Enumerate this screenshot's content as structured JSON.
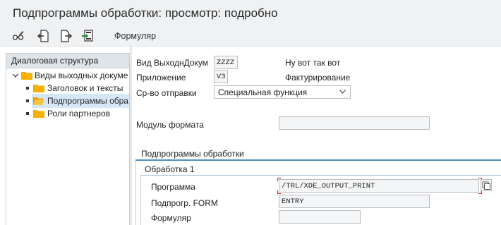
{
  "window": {
    "title": "Подпрограммы обработки: просмотр: подробно"
  },
  "toolbar": {
    "icons": [
      "glasses-edit-icon",
      "previous-entry-icon",
      "next-entry-icon",
      "transport-icon"
    ],
    "formular_label": "Формуляр"
  },
  "tree": {
    "header": "Диалоговая структура",
    "items": [
      {
        "label": "Виды выходных докуме",
        "level": 0,
        "expanded": true,
        "selected": false
      },
      {
        "label": "Заголовок и тексты",
        "level": 1,
        "selected": false
      },
      {
        "label": "Подпрограммы обра",
        "level": 1,
        "selected": true
      },
      {
        "label": "Роли партнеров",
        "level": 1,
        "selected": false
      }
    ]
  },
  "form": {
    "output_type": {
      "label": "Вид ВыходнДокум",
      "value": "ZZZZ",
      "description": "Ну вот так вот"
    },
    "application": {
      "label": "Приложение",
      "value": "V3",
      "description": "Фактурирование"
    },
    "transmission": {
      "label": "Ср-во отправки",
      "value": "Специальная функция"
    },
    "format_module": {
      "label": "Модуль формата",
      "value": ""
    }
  },
  "processing": {
    "group_title": "Подпрограммы обработки",
    "subgroup_title": "Обработка 1",
    "program": {
      "label": "Программа",
      "value": "/TRL/XDE_OUTPUT_PRINT"
    },
    "form_routine": {
      "label": "Подпрогр. FORM",
      "value": "ENTRY"
    },
    "formular": {
      "label": "Формуляр",
      "value": ""
    }
  },
  "colors": {
    "accent": "#4a90c4",
    "focus_corner": "#d0342c",
    "folder": "#f5b000",
    "selection": "#d6e8f7"
  }
}
